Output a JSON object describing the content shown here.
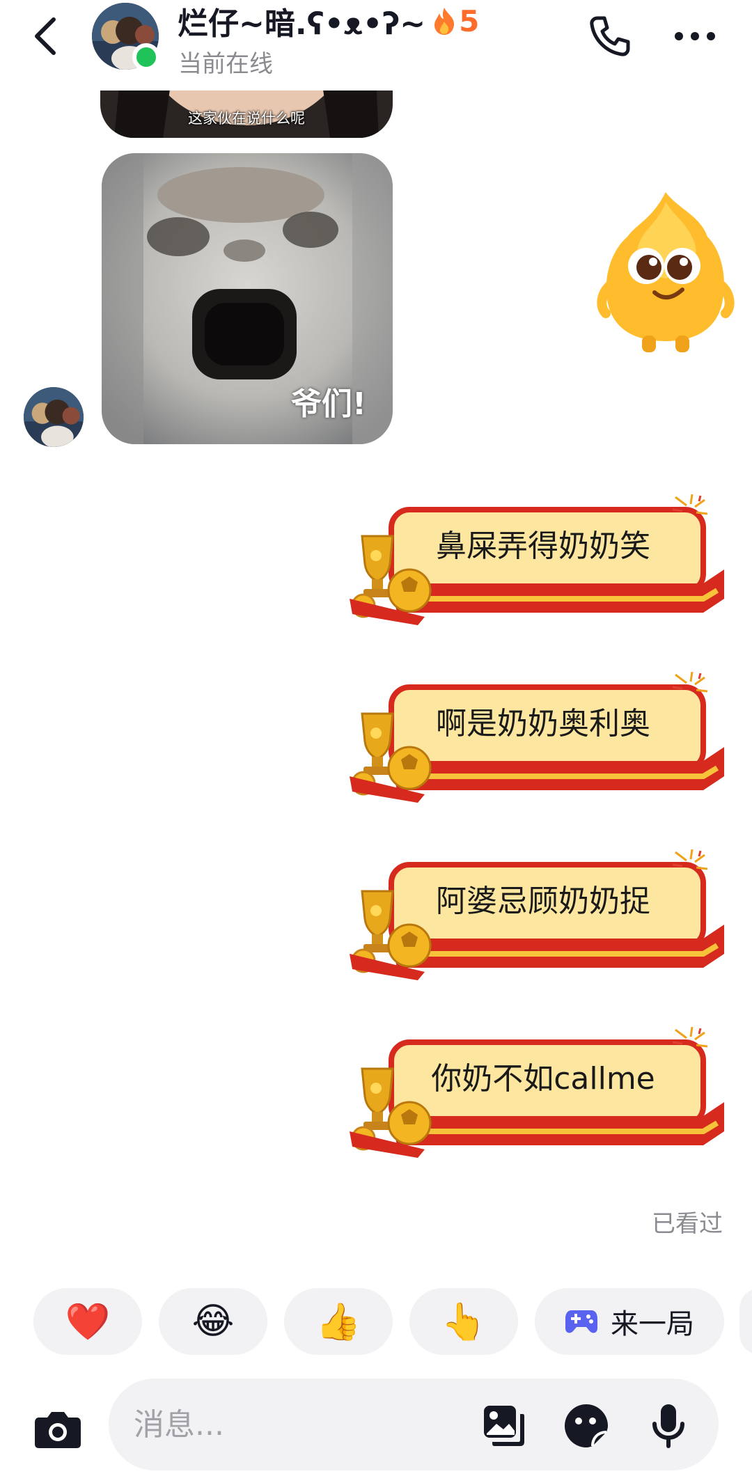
{
  "header": {
    "contact_name": "烂仔~暗.ʕ•ᴥ•ʔ~",
    "streak_count": "5",
    "status": "当前在线",
    "icons": [
      "back-arrow-icon",
      "phone-icon",
      "more-dots-icon",
      "fire-icon"
    ]
  },
  "messages": {
    "image_top_caption": "这家伙在说什么呢",
    "image_main_caption": "爷们!",
    "bubbles": [
      {
        "text": "鼻屎弄得奶奶笑"
      },
      {
        "text": "啊是奶奶奥利奥"
      },
      {
        "text": "阿婆忌顾奶奶捉"
      },
      {
        "text": "你奶不如callme"
      }
    ],
    "read_status": "已看过"
  },
  "quick_replies": {
    "emojis": [
      "❤️",
      "😂",
      "👍",
      "👆"
    ],
    "game_label": "来一局"
  },
  "input": {
    "placeholder": "消息...",
    "value": ""
  },
  "colors": {
    "accent_fire": "#fe6c2c",
    "online": "#20c35a",
    "bubble_fill": "#fde6a0",
    "bubble_border": "#d62a1e",
    "game_icon": "#5a62f0"
  }
}
